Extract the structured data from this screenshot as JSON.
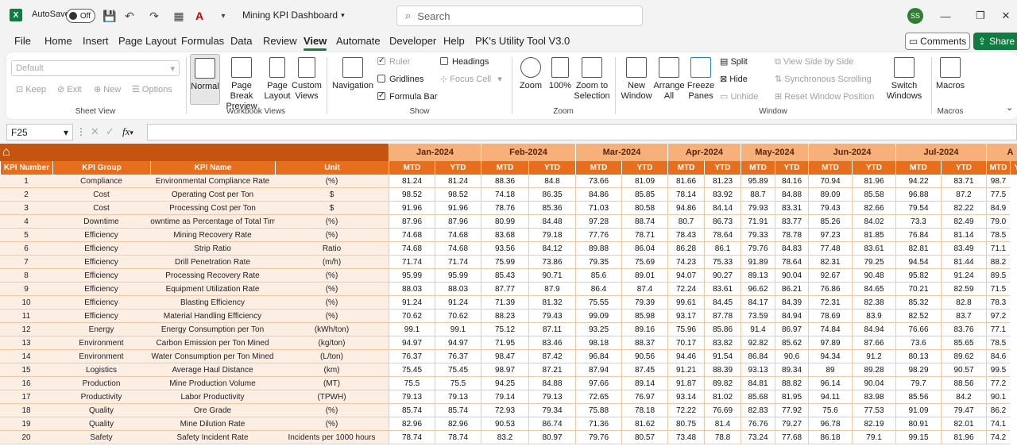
{
  "titlebar": {
    "app_icon": "X",
    "autosave": "AutoSave",
    "toggle": "Off",
    "title": "Mining KPI Dashboard",
    "search_placeholder": "Search",
    "avatar": "SS"
  },
  "menu": {
    "tabs": [
      "File",
      "Home",
      "Insert",
      "Page Layout",
      "Formulas",
      "Data",
      "Review",
      "View",
      "Automate",
      "Developer",
      "Help",
      "PK's Utility Tool V3.0"
    ],
    "active": "View",
    "comments": "Comments",
    "share": "Share"
  },
  "ribbon": {
    "sheet_view": {
      "dropdown": "Default",
      "keep": "Keep",
      "exit": "Exit",
      "new": "New",
      "options": "Options",
      "group": "Sheet View"
    },
    "workbook_views": {
      "normal": "Normal",
      "page_break": "Page Break Preview",
      "page_layout": "Page Layout",
      "custom": "Custom Views",
      "group": "Workbook Views"
    },
    "show": {
      "navigation": "Navigation",
      "ruler": "Ruler",
      "gridlines": "Gridlines",
      "formula_bar": "Formula Bar",
      "headings": "Headings",
      "focus_cell": "Focus Cell",
      "group": "Show"
    },
    "zoom": {
      "zoom": "Zoom",
      "pct": "100%",
      "selection": "Zoom to Selection",
      "group": "Zoom"
    },
    "window": {
      "new_window": "New Window",
      "arrange": "Arrange All",
      "freeze": "Freeze Panes",
      "split": "Split",
      "hide": "Hide",
      "unhide": "Unhide",
      "side_by_side": "View Side by Side",
      "sync": "Synchronous Scrolling",
      "reset": "Reset Window Position",
      "switch": "Switch Windows",
      "group": "Window"
    },
    "macros": {
      "label": "Macros",
      "group": "Macros"
    }
  },
  "formula_bar": {
    "name_box": "F25",
    "fx": "fx"
  },
  "sheet": {
    "headers": [
      "KPI Number",
      "KPI Group",
      "KPI Name",
      "Unit"
    ],
    "months": [
      "Jan-2024",
      "Feb-2024",
      "Mar-2024",
      "Apr-2024",
      "May-2024",
      "Jun-2024",
      "Jul-2024",
      "A"
    ],
    "sub": [
      "MTD",
      "YTD"
    ],
    "rows": [
      [
        "1",
        "Compliance",
        "Environmental Compliance Rate",
        "(%)",
        "81.24",
        "81.24",
        "88.36",
        "84.8",
        "73.66",
        "81.09",
        "81.66",
        "81.23",
        "95.89",
        "84.16",
        "70.94",
        "81.96",
        "94.22",
        "83.71",
        "98.7"
      ],
      [
        "2",
        "Cost",
        "Operating Cost per Ton",
        "$",
        "98.52",
        "98.52",
        "74.18",
        "86.35",
        "84.86",
        "85.85",
        "78.14",
        "83.92",
        "88.7",
        "84.88",
        "89.09",
        "85.58",
        "96.88",
        "87.2",
        "77.5"
      ],
      [
        "3",
        "Cost",
        "Processing Cost per Ton",
        "$",
        "91.96",
        "91.96",
        "78.76",
        "85.36",
        "71.03",
        "80.58",
        "94.86",
        "84.14",
        "79.93",
        "83.31",
        "79.43",
        "82.66",
        "79.54",
        "82.22",
        "84.9"
      ],
      [
        "4",
        "Downtime",
        "Downtime as Percentage of Total Time",
        "(%)",
        "87.96",
        "87.96",
        "80.99",
        "84.48",
        "97.28",
        "88.74",
        "80.7",
        "86.73",
        "71.91",
        "83.77",
        "85.26",
        "84.02",
        "73.3",
        "82.49",
        "79.0"
      ],
      [
        "5",
        "Efficiency",
        "Mining Recovery Rate",
        "(%)",
        "74.68",
        "74.68",
        "83.68",
        "79.18",
        "77.76",
        "78.71",
        "78.43",
        "78.64",
        "79.33",
        "78.78",
        "97.23",
        "81.85",
        "76.84",
        "81.14",
        "78.5"
      ],
      [
        "6",
        "Efficiency",
        "Strip Ratio",
        "Ratio",
        "74.68",
        "74.68",
        "93.56",
        "84.12",
        "89.88",
        "86.04",
        "86.28",
        "86.1",
        "79.76",
        "84.83",
        "77.48",
        "83.61",
        "82.81",
        "83.49",
        "71.1"
      ],
      [
        "7",
        "Efficiency",
        "Drill Penetration Rate",
        "(m/h)",
        "71.74",
        "71.74",
        "75.99",
        "73.86",
        "79.35",
        "75.69",
        "74.23",
        "75.33",
        "91.89",
        "78.64",
        "82.31",
        "79.25",
        "94.54",
        "81.44",
        "88.2"
      ],
      [
        "8",
        "Efficiency",
        "Processing Recovery Rate",
        "(%)",
        "95.99",
        "95.99",
        "85.43",
        "90.71",
        "85.6",
        "89.01",
        "94.07",
        "90.27",
        "89.13",
        "90.04",
        "92.67",
        "90.48",
        "95.82",
        "91.24",
        "89.5"
      ],
      [
        "9",
        "Efficiency",
        "Equipment Utilization Rate",
        "(%)",
        "88.03",
        "88.03",
        "87.77",
        "87.9",
        "86.4",
        "87.4",
        "72.24",
        "83.61",
        "96.62",
        "86.21",
        "76.86",
        "84.65",
        "70.21",
        "82.59",
        "71.5"
      ],
      [
        "10",
        "Efficiency",
        "Blasting Efficiency",
        "(%)",
        "91.24",
        "91.24",
        "71.39",
        "81.32",
        "75.55",
        "79.39",
        "99.61",
        "84.45",
        "84.17",
        "84.39",
        "72.31",
        "82.38",
        "85.32",
        "82.8",
        "78.3"
      ],
      [
        "11",
        "Efficiency",
        "Material Handling Efficiency",
        "(%)",
        "70.62",
        "70.62",
        "88.23",
        "79.43",
        "99.09",
        "85.98",
        "93.17",
        "87.78",
        "73.59",
        "84.94",
        "78.69",
        "83.9",
        "82.52",
        "83.7",
        "97.2"
      ],
      [
        "12",
        "Energy",
        "Energy Consumption per Ton",
        "(kWh/ton)",
        "99.1",
        "99.1",
        "75.12",
        "87.11",
        "93.25",
        "89.16",
        "75.96",
        "85.86",
        "91.4",
        "86.97",
        "74.84",
        "84.94",
        "76.66",
        "83.76",
        "77.1"
      ],
      [
        "13",
        "Environment",
        "Carbon Emission per Ton Mined",
        "(kg/ton)",
        "94.97",
        "94.97",
        "71.95",
        "83.46",
        "98.18",
        "88.37",
        "70.17",
        "83.82",
        "92.82",
        "85.62",
        "97.89",
        "87.66",
        "73.6",
        "85.65",
        "78.5"
      ],
      [
        "14",
        "Environment",
        "Water Consumption per Ton Mined",
        "(L/ton)",
        "76.37",
        "76.37",
        "98.47",
        "87.42",
        "96.84",
        "90.56",
        "94.46",
        "91.54",
        "86.84",
        "90.6",
        "94.34",
        "91.2",
        "80.13",
        "89.62",
        "84.6"
      ],
      [
        "15",
        "Logistics",
        "Average Haul Distance",
        "(km)",
        "75.45",
        "75.45",
        "98.97",
        "87.21",
        "87.94",
        "87.45",
        "91.21",
        "88.39",
        "93.13",
        "89.34",
        "89",
        "89.28",
        "98.29",
        "90.57",
        "99.5"
      ],
      [
        "16",
        "Production",
        "Mine Production Volume",
        "(MT)",
        "75.5",
        "75.5",
        "94.25",
        "84.88",
        "97.66",
        "89.14",
        "91.87",
        "89.82",
        "84.81",
        "88.82",
        "96.14",
        "90.04",
        "79.7",
        "88.56",
        "77.2"
      ],
      [
        "17",
        "Productivity",
        "Labor Productivity",
        "(TPWH)",
        "79.13",
        "79.13",
        "79.14",
        "79.13",
        "72.65",
        "76.97",
        "93.14",
        "81.02",
        "85.68",
        "81.95",
        "94.11",
        "83.98",
        "85.56",
        "84.2",
        "90.1"
      ],
      [
        "18",
        "Quality",
        "Ore Grade",
        "(%)",
        "85.74",
        "85.74",
        "72.93",
        "79.34",
        "75.88",
        "78.18",
        "72.22",
        "76.69",
        "82.83",
        "77.92",
        "75.6",
        "77.53",
        "91.09",
        "79.47",
        "86.2"
      ],
      [
        "19",
        "Quality",
        "Mine Dilution Rate",
        "(%)",
        "82.96",
        "82.96",
        "90.53",
        "86.74",
        "71.36",
        "81.62",
        "80.75",
        "81.4",
        "76.76",
        "79.27",
        "96.78",
        "82.19",
        "80.91",
        "82.01",
        "74.1"
      ],
      [
        "20",
        "Safety",
        "Safety Incident Rate",
        "Incidents per 1000 hours",
        "78.74",
        "78.74",
        "83.2",
        "80.97",
        "79.76",
        "80.57",
        "73.48",
        "78.8",
        "73.24",
        "77.68",
        "86.18",
        "79.1",
        "99.15",
        "81.96",
        "74.2"
      ]
    ]
  }
}
